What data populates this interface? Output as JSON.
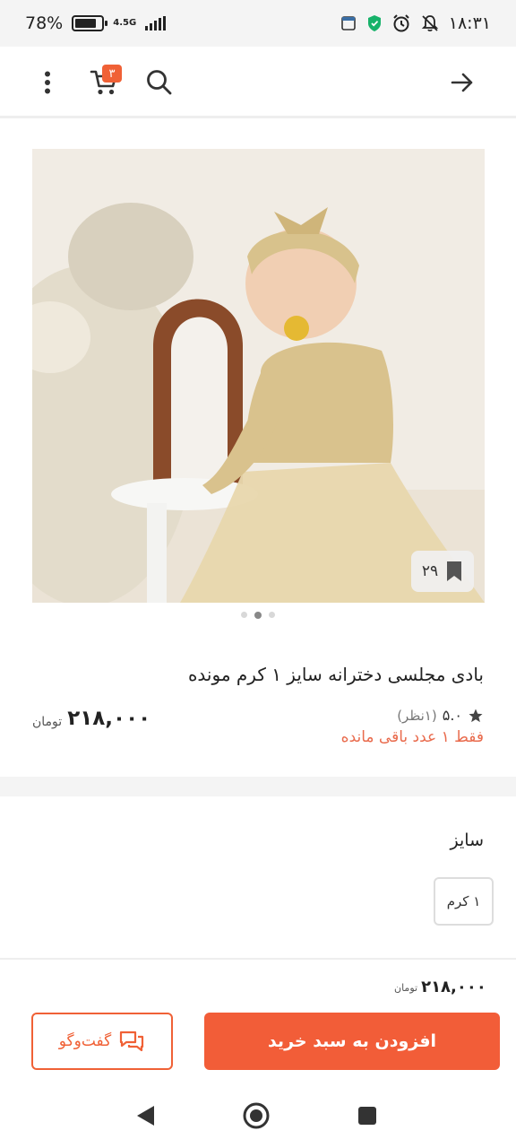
{
  "status_bar": {
    "battery_percent": "78%",
    "network": "4.5G",
    "time": "۱۸:۳۱"
  },
  "app_bar": {
    "cart_count": "۳",
    "icons": [
      "more-vert-icon",
      "cart-icon",
      "search-icon",
      "arrow-right-icon"
    ]
  },
  "product": {
    "saved_count": "۲۹",
    "title": "بادی مجلسی دخترانه سایز ۱ کرم مونده",
    "rating": "۵.۰",
    "rating_count": "(۱نظر)",
    "stock_text": "فقط ۱ عدد باقی مانده",
    "price": "۲۱۸,۰۰۰",
    "currency": "تومان"
  },
  "size_section": {
    "title": "سایز",
    "options": [
      "۱ کرم"
    ]
  },
  "bottom_bar": {
    "price": "۲۱۸,۰۰۰",
    "currency": "تومان",
    "chat_label": "گفت‌وگو",
    "add_to_cart_label": "افزودن به سبد خرید"
  },
  "colors": {
    "accent": "#f25d38",
    "stock": "#e96b4d"
  }
}
